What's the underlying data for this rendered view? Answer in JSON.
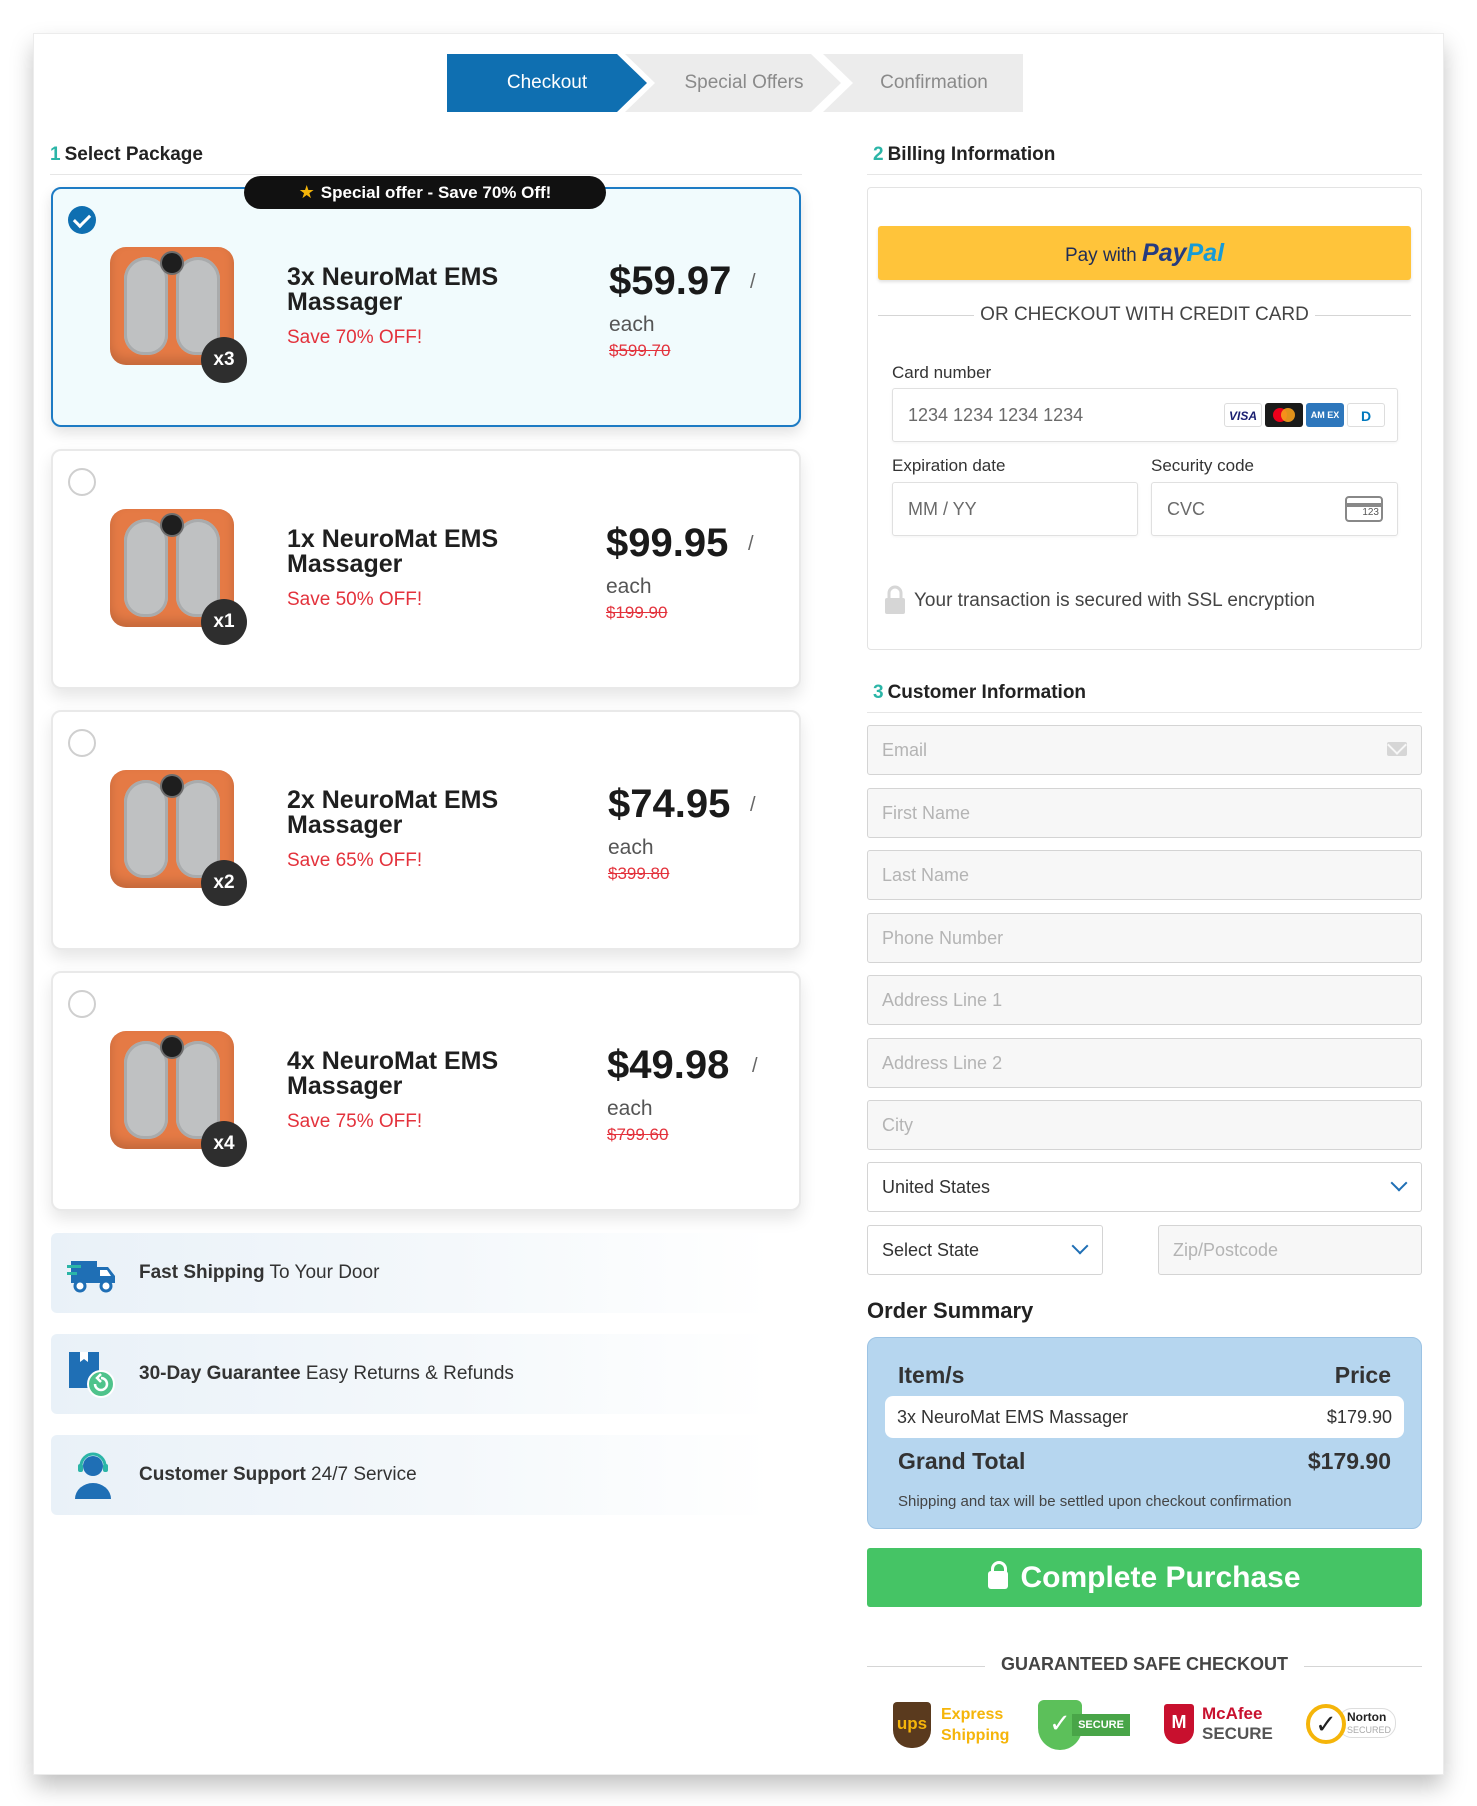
{
  "steps": [
    "Checkout",
    "Special Offers",
    "Confirmation"
  ],
  "select_package": {
    "number": "1",
    "title": "Select Package"
  },
  "offer_badge": "Special offer - Save 70% Off!",
  "packages": [
    {
      "name": "3x NeuroMat EMS Massager",
      "save": "Save 70% OFF!",
      "price": "$59.97",
      "slash": "/",
      "each": "each",
      "original": "$599.70",
      "qty": "x3",
      "selected": true
    },
    {
      "name": "1x NeuroMat EMS Massager",
      "save": "Save 50% OFF!",
      "price": "$99.95",
      "slash": "/",
      "each": "each",
      "original": "$199.90",
      "qty": "x1",
      "selected": false
    },
    {
      "name": "2x NeuroMat EMS Massager",
      "save": "Save 65% OFF!",
      "price": "$74.95",
      "slash": "/",
      "each": "each",
      "original": "$399.80",
      "qty": "x2",
      "selected": false
    },
    {
      "name": "4x NeuroMat EMS Massager",
      "save": "Save 75% OFF!",
      "price": "$49.98",
      "slash": "/",
      "each": "each",
      "original": "$799.60",
      "qty": "x4",
      "selected": false
    }
  ],
  "trust": [
    {
      "bold": "Fast Shipping",
      "text": " To Your Door",
      "icon": "truck-icon"
    },
    {
      "bold": "30-Day Guarantee",
      "text": " Easy Returns & Refunds",
      "icon": "guarantee-box-icon"
    },
    {
      "bold": "Customer Support",
      "text": " 24/7 Service",
      "icon": "support-agent-icon"
    }
  ],
  "billing": {
    "number": "2",
    "title": "Billing Information",
    "paypal_prefix": "Pay with",
    "paypal_logo_a": "Pay",
    "paypal_logo_b": "Pal",
    "or_text": "OR CHECKOUT WITH CREDIT CARD",
    "card_label": "Card number",
    "card_placeholder": "1234 1234 1234 1234",
    "card_logos": [
      "VISA",
      "",
      "AM EX",
      "D"
    ],
    "exp_label": "Expiration date",
    "exp_placeholder": "MM / YY",
    "sec_label": "Security code",
    "sec_placeholder": "CVC",
    "cvc_icon_text": "123",
    "ssl_text": "Your transaction is secured with SSL encryption"
  },
  "customer": {
    "number": "3",
    "title": "Customer Information",
    "fields": [
      "Email",
      "First Name",
      "Last Name",
      "Phone Number",
      "Address Line 1",
      "Address Line 2",
      "City"
    ],
    "country": "United States",
    "state": "Select State",
    "zip": "Zip/Postcode"
  },
  "order_summary": {
    "title": "Order Summary",
    "col_item": "Item/s",
    "col_price": "Price",
    "item_name": "3x NeuroMat EMS Massager",
    "item_price": "$179.90",
    "grand_label": "Grand Total",
    "grand_value": "$179.90",
    "note": "Shipping and tax will be settled upon checkout confirmation"
  },
  "complete_button": "Complete Purchase",
  "guarantee_title": "GUARANTEED SAFE CHECKOUT",
  "badges": {
    "ups_logo": "ups",
    "ups_line1": "Express",
    "ups_line2": "Shipping",
    "secure": "SECURE",
    "mcafee_line1": "McAfee",
    "mcafee_line2": "SECURE",
    "norton_line1": "Norton",
    "norton_line2": "SECURED"
  },
  "colors": {
    "primary": "#0f6fb1",
    "accent_green": "#45c465",
    "sale_red": "#e3323c",
    "paypal_yellow": "#ffc43a",
    "summary_blue": "#b6d6ef"
  }
}
